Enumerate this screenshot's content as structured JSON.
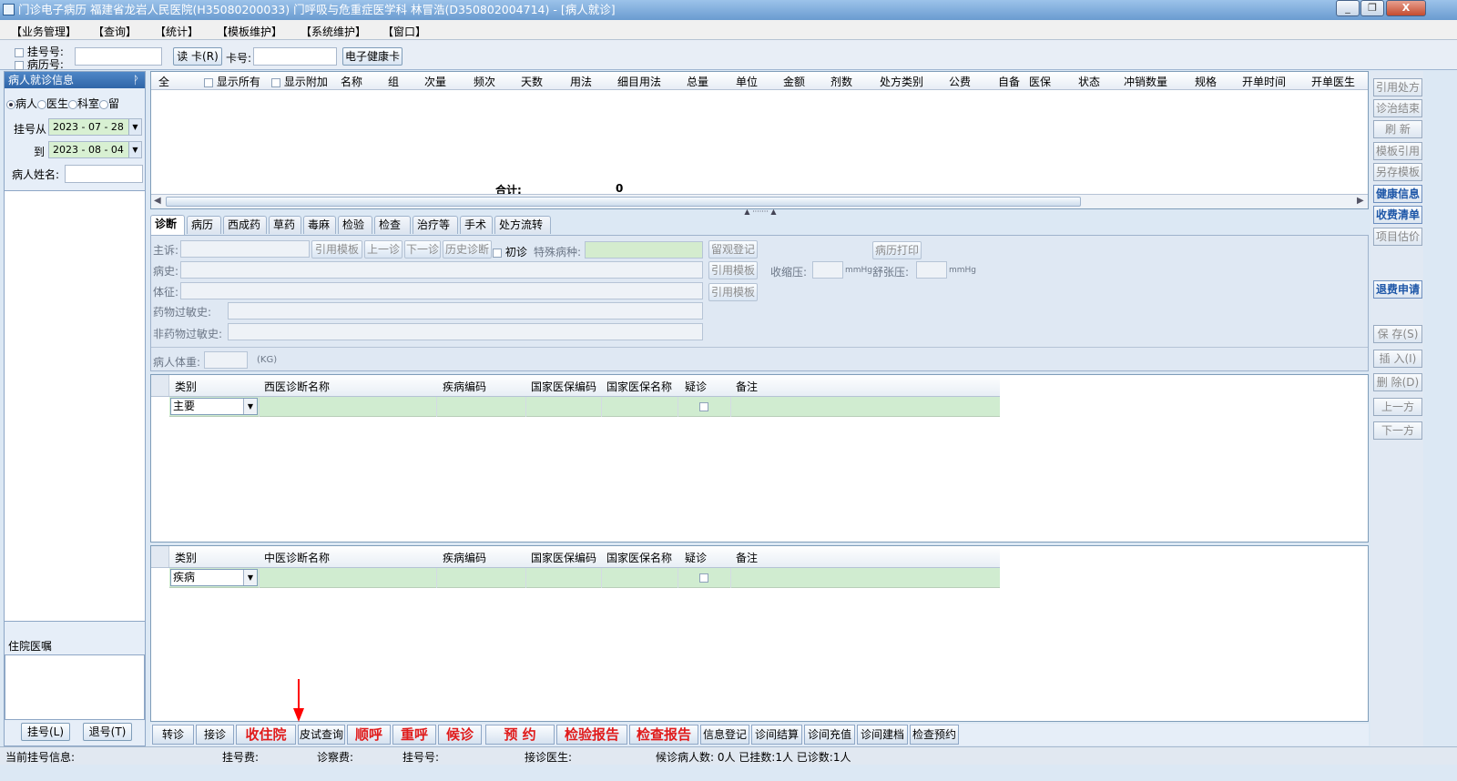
{
  "window": {
    "title": "门诊电子病历  福建省龙岩人民医院(H35080200033)  门呼吸与危重症医学科  林冒浩(D350802004714)  -  [病人就诊]",
    "min": "_",
    "restore": "❐",
    "close": "X"
  },
  "menu": [
    "【业务管理】",
    "【查询】",
    "【统计】",
    "【模板维护】",
    "【系统维护】",
    "【窗口】"
  ],
  "toolbar": {
    "reg_no_label": "挂号号:",
    "record_no_label": "病历号:",
    "read_card": "读 卡(R)",
    "card_no_label": "卡号:",
    "health_card": "电子健康卡"
  },
  "left": {
    "header": "病人就诊信息",
    "pin": "ᚹ",
    "radios": [
      "病人",
      "医生",
      "科室",
      "留"
    ],
    "reg_from_label": "挂号从",
    "reg_from": "2023 - 07 - 28",
    "to_label": "到",
    "reg_to": "2023 - 08 - 04",
    "name_label": "病人姓名:",
    "inpatient_header": "住院医嘱",
    "register_btn": "挂号(L)",
    "unregister_btn": "退号(T)"
  },
  "rx": {
    "headers": [
      "全",
      "显示所有",
      "显示附加",
      "名称",
      "组",
      "次量",
      "频次",
      "天数",
      "用法",
      "细目用法",
      "总量",
      "单位",
      "金额",
      "剂数",
      "处方类别",
      "公费",
      "自备",
      "医保",
      "状态",
      "冲销数量",
      "规格",
      "开单时间",
      "开单医生"
    ],
    "total_label": "合计:",
    "total_value": "0"
  },
  "tabs": [
    "诊断",
    "病历",
    "西成药",
    "草药",
    "毒麻",
    "检验",
    "检查",
    "治疗等",
    "手术",
    "处方流转"
  ],
  "form": {
    "chief_label": "主诉:",
    "history_label": "病史:",
    "sign_label": "体征:",
    "drug_allergy_label": "药物过敏史:",
    "nondrug_allergy_label": "非药物过敏史:",
    "ref_template": "引用模板",
    "prev_visit": "上一诊",
    "next_visit": "下一诊",
    "history_dx": "历史诊断",
    "first_visit": "初诊",
    "special_label": "特殊病种:",
    "observe": "留观登记",
    "print_record": "病历打印",
    "systolic_label": "收缩压:",
    "diastolic_label": "舒张压:",
    "unit_mmhg": "mmHg",
    "weight_label": "病人体重:",
    "unit_kg": "(KG)"
  },
  "western_dx": {
    "headers": [
      "类别",
      "西医诊断名称",
      "疾病编码",
      "国家医保编码",
      "国家医保名称",
      "疑诊",
      "备注"
    ],
    "row_type": "主要"
  },
  "chinese_dx": {
    "headers": [
      "类别",
      "中医诊断名称",
      "疾病编码",
      "国家医保编码",
      "国家医保名称",
      "疑诊",
      "备注"
    ],
    "row_type": "疾病"
  },
  "bottom_buttons": [
    {
      "label": "转诊",
      "red": false
    },
    {
      "label": "接诊",
      "red": false
    },
    {
      "label": "收住院",
      "red": true
    },
    {
      "label": "皮试查询",
      "red": false
    },
    {
      "label": "顺呼",
      "red": true
    },
    {
      "label": "重呼",
      "red": true
    },
    {
      "label": "候诊",
      "red": true
    },
    {
      "label": "预   约",
      "red": true
    },
    {
      "label": "检验报告",
      "red": true
    },
    {
      "label": "检查报告",
      "red": true
    },
    {
      "label": "信息登记",
      "red": false
    },
    {
      "label": "诊间结算",
      "red": false
    },
    {
      "label": "诊间充值",
      "red": false
    },
    {
      "label": "诊间建档",
      "red": false
    },
    {
      "label": "检查预约",
      "red": false
    }
  ],
  "right_buttons": [
    {
      "label": "引用处方",
      "style": "gray"
    },
    {
      "label": "诊治结束",
      "style": "gray"
    },
    {
      "label": "刷 新",
      "style": "gray"
    },
    {
      "label": "模板引用",
      "style": "gray"
    },
    {
      "label": "另存模板",
      "style": "gray"
    },
    {
      "label": "健康信息",
      "style": "blue"
    },
    {
      "label": "收费清单",
      "style": "blue"
    },
    {
      "label": "项目估价",
      "style": "gray"
    },
    {
      "label": "退费申请",
      "style": "blue"
    },
    {
      "label": "保 存(S)",
      "style": "gray"
    },
    {
      "label": "插 入(I)",
      "style": "gray"
    },
    {
      "label": "删 除(D)",
      "style": "gray"
    },
    {
      "label": "上一方",
      "style": "gray"
    },
    {
      "label": "下一方",
      "style": "gray"
    }
  ],
  "status": {
    "current_reg": "当前挂号信息:",
    "reg_fee": "挂号费:",
    "exam_fee": "诊察费:",
    "reg_no": "挂号号:",
    "doctor": "接诊医生:",
    "counts": "候诊病人数: 0人  已挂数:1人  已诊数:1人"
  },
  "colors": {
    "red_button": "#e01b1b",
    "green_row": "#d0ecd0",
    "title_blue": "#6a9bd0",
    "arrow": "#ff0000"
  }
}
